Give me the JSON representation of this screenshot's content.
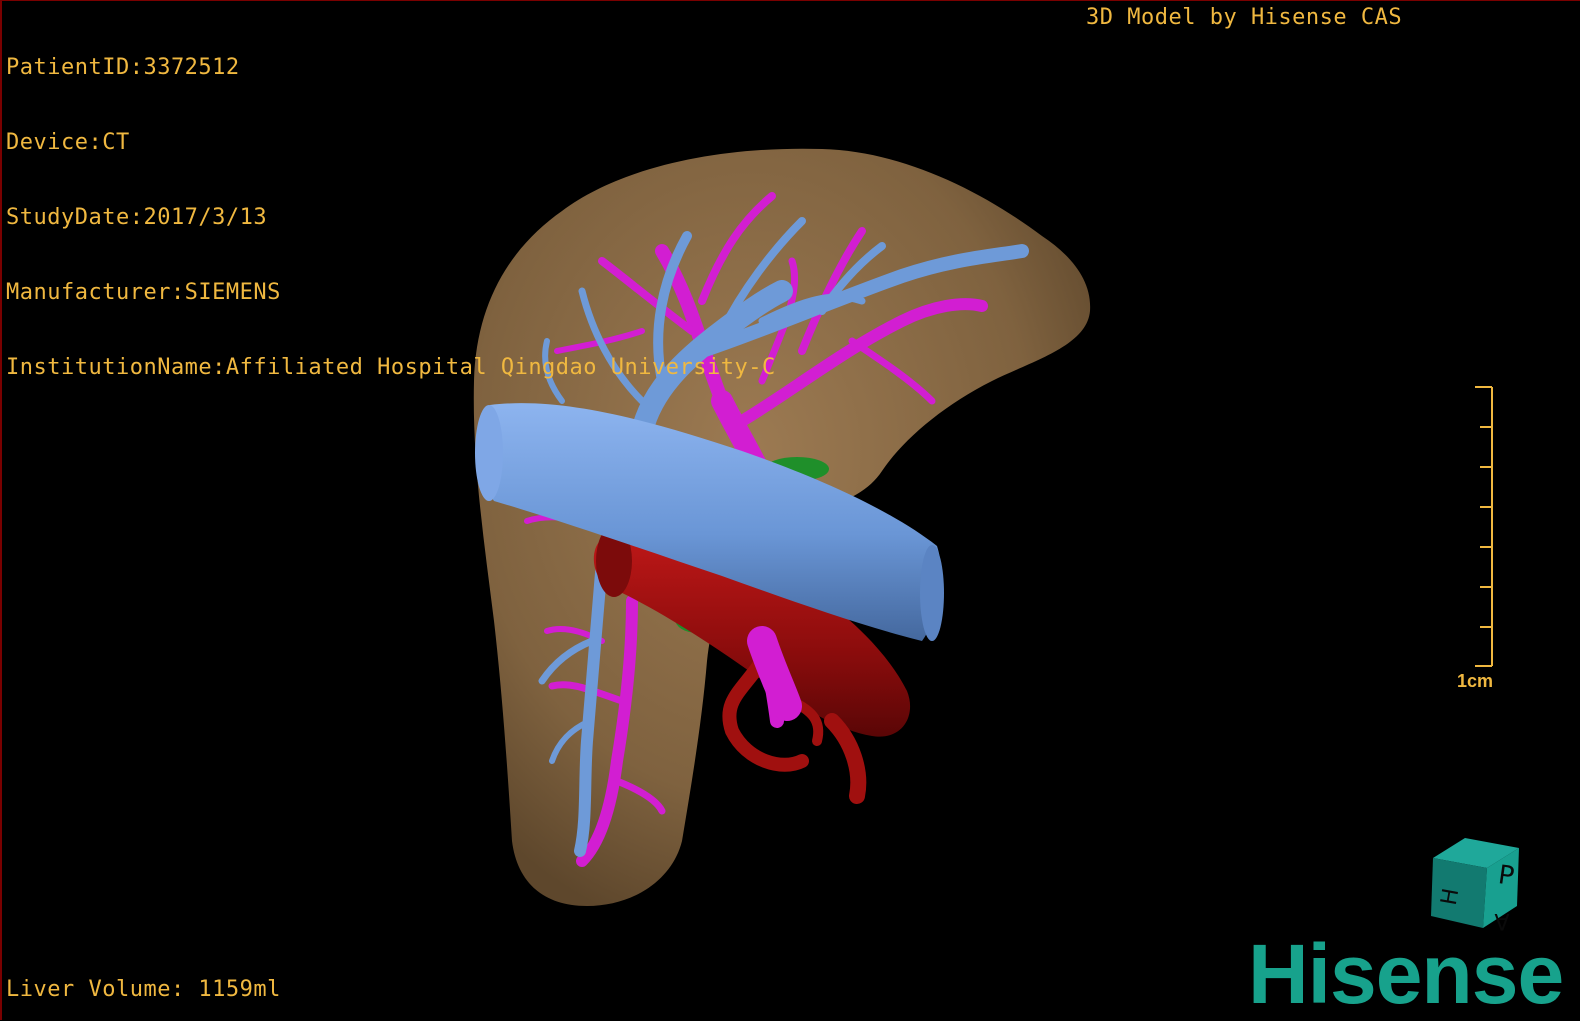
{
  "window": {
    "info": {
      "patient_id": "PatientID:3372512",
      "device": "Device:CT",
      "study_date": "StudyDate:2017/3/13",
      "manufacturer": "Manufacturer:SIEMENS",
      "institution": "InstitutionName:Affiliated Hospital Qingdao University-C"
    },
    "model_credit": "3D Model by Hisense CAS",
    "liver_volume": "Liver Volume: 1159ml",
    "scale_bar_label": "1cm",
    "brand": "Hisense"
  },
  "orientation_cube": {
    "face_letters": [
      "P",
      "H",
      "A"
    ]
  },
  "colors": {
    "text_overlay": "#f0b840",
    "liver": "#8a6a45",
    "hepatic_vein": "#6e9ad8",
    "portal_vein": "#d21ed2",
    "artery": "#9a0f0f",
    "bile": "#1f8f2a",
    "brand": "#17a28c"
  },
  "icons": {
    "orientation_cube": "orientation-cube-icon",
    "scale_bar": "scale-bar-icon"
  }
}
